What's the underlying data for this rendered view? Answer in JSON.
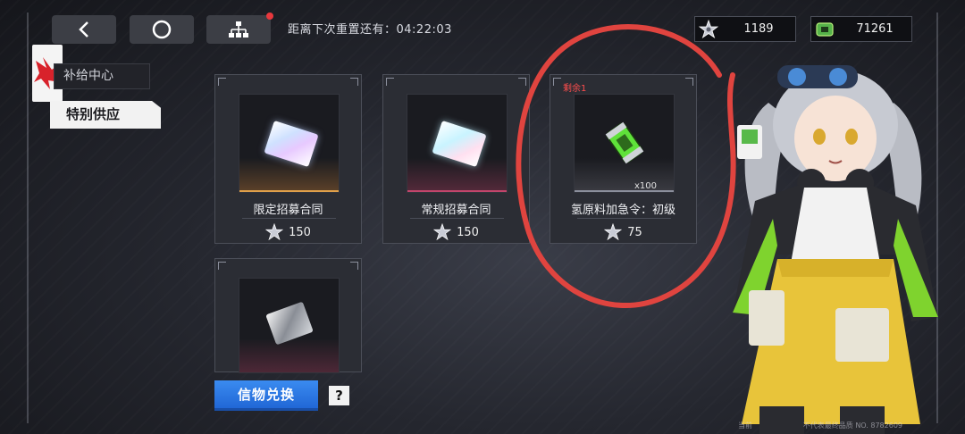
{
  "header": {
    "reset_label": "距离下次重置还有：04:22:03",
    "currency_silver": "1189",
    "currency_green": "71261"
  },
  "nav": {
    "item_supply": "补给中心",
    "item_special": "特别供应"
  },
  "cards": [
    {
      "name": "限定招募合同",
      "price": "150"
    },
    {
      "name": "常规招募合同",
      "price": "150"
    },
    {
      "name": "氢原料加急令：初级",
      "price": "75",
      "quantity": "x100",
      "remaining": "剩余1"
    },
    {
      "name": "",
      "price": ""
    }
  ],
  "footer": {
    "exchange_label": "信物兑换",
    "help_label": "?"
  },
  "watermark": {
    "left": "当前",
    "right": "不代表最终品质 NO. 8782609"
  },
  "colors": {
    "accent_blue": "#2a77e4",
    "highlight_red": "#e0443f",
    "rarity_gold": "#d98a3a",
    "rarity_pink": "#c2456b"
  }
}
